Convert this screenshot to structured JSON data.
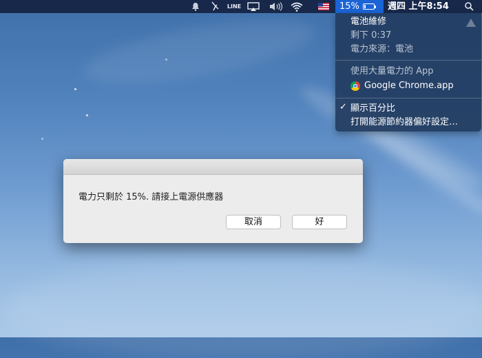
{
  "menubar": {
    "icons": [
      "bell-icon",
      "brush-icon",
      "line-app-icon",
      "airplay-icon",
      "volume-icon",
      "wifi-icon",
      "us-flag-icon",
      "spotlight-search-icon"
    ],
    "line_label": "LINE",
    "battery_percent": "15%",
    "battery_level": 0.15,
    "clock": "週四 上午8:54"
  },
  "battery_menu": {
    "condition": "電池維修",
    "remaining": "剩下 0:37",
    "power_source": "電力來源：電池",
    "significant_energy_header": "使用大量電力的 App",
    "app_name": "Google Chrome.app",
    "show_percentage": "顯示百分比",
    "show_percentage_checked": true,
    "check_mark": "✓",
    "open_energy_saver": "打開能源節約器偏好設定…",
    "warning_icon": "warning-icon"
  },
  "dialog": {
    "message": "電力只剩於 15%. 請接上電源供應器",
    "cancel_label": "取消",
    "ok_label": "好"
  },
  "colors": {
    "menubar": "#17284a",
    "battery_highlight": "#1a64d6",
    "menu_bg": "#233c5f",
    "dialog_bg": "#ececec"
  }
}
